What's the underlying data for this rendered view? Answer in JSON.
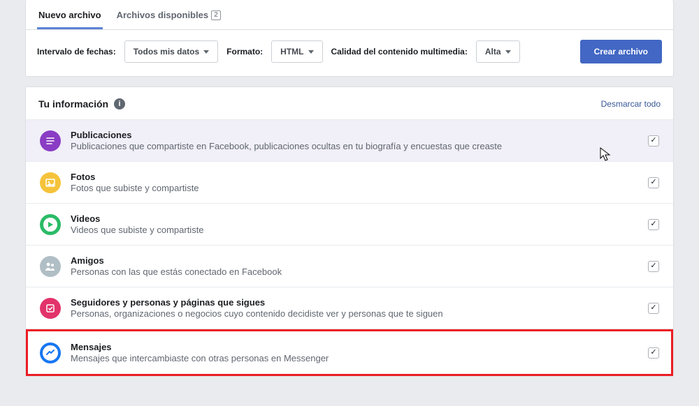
{
  "tabs": {
    "new_file": "Nuevo archivo",
    "available": "Archivos disponibles",
    "available_count": "2"
  },
  "filters": {
    "date_range_label": "Intervalo de fechas:",
    "date_range_value": "Todos mis datos",
    "format_label": "Formato:",
    "format_value": "HTML",
    "media_quality_label": "Calidad del contenido multimedia:",
    "media_quality_value": "Alta",
    "create_button": "Crear archivo"
  },
  "info": {
    "heading": "Tu información",
    "deselect_all": "Desmarcar todo"
  },
  "colors": {
    "posts": "#8a3cc4",
    "photos": "#f5c33b",
    "videos": "#2abb67",
    "friends": "#b0bec5",
    "followers": "#e2336b",
    "messages": "#1877f2"
  },
  "items": {
    "posts": {
      "title": "Publicaciones",
      "desc": "Publicaciones que compartiste en Facebook, publicaciones ocultas en tu biografía y encuestas que creaste"
    },
    "photos": {
      "title": "Fotos",
      "desc": "Fotos que subiste y compartiste"
    },
    "videos": {
      "title": "Videos",
      "desc": "Videos que subiste y compartiste"
    },
    "friends": {
      "title": "Amigos",
      "desc": "Personas con las que estás conectado en Facebook"
    },
    "followers": {
      "title": "Seguidores y personas y páginas que sigues",
      "desc": "Personas, organizaciones o negocios cuyo contenido decidiste ver y personas que te siguen"
    },
    "messages": {
      "title": "Mensajes",
      "desc": "Mensajes que intercambiaste con otras personas en Messenger"
    }
  }
}
